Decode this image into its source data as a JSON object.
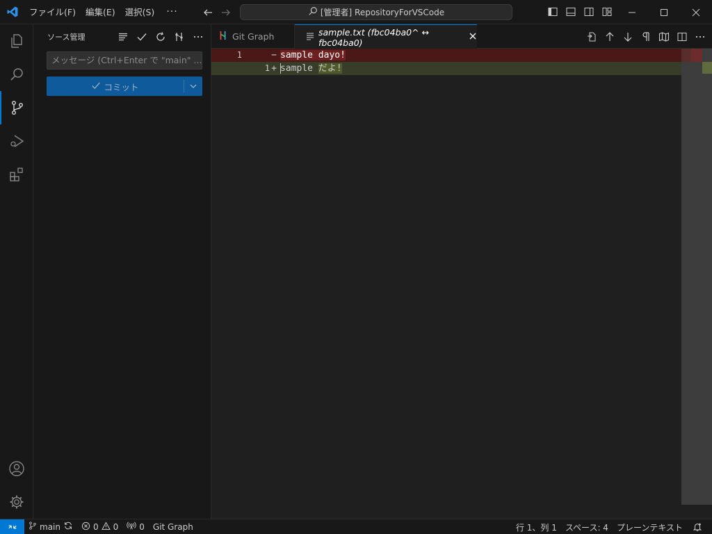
{
  "menu": {
    "file": "ファイル(F)",
    "edit": "編集(E)",
    "selection": "選択(S)",
    "more": "···"
  },
  "command_center": {
    "text": "[管理者] RepositoryForVSCode"
  },
  "sidebar": {
    "title": "ソース管理",
    "message_placeholder": "メッセージ (Ctrl+Enter で \"main\" ...",
    "commit_label": "コミット"
  },
  "tabs": [
    {
      "label": "Git Graph",
      "active": false
    },
    {
      "label": "sample.txt (fbc04ba0^ ↔ fbc04ba0)",
      "active": true
    }
  ],
  "diff": {
    "original": {
      "line_number": "1",
      "sign": "−",
      "text": "sample dayo!"
    },
    "modified": {
      "line_number": "1",
      "sign": "+",
      "prefix": "sample ",
      "changed": "だよ!"
    }
  },
  "statusbar": {
    "branch": "main",
    "errors": "0",
    "warnings": "0",
    "ports": "0",
    "git_graph": "Git Graph",
    "position": "行 1、列 1",
    "spaces": "スペース: 4",
    "language": "プレーンテキスト"
  },
  "colors": {
    "accent": "#0078d4",
    "deleted_line": "#4b1818",
    "inserted_line": "#373d29"
  }
}
